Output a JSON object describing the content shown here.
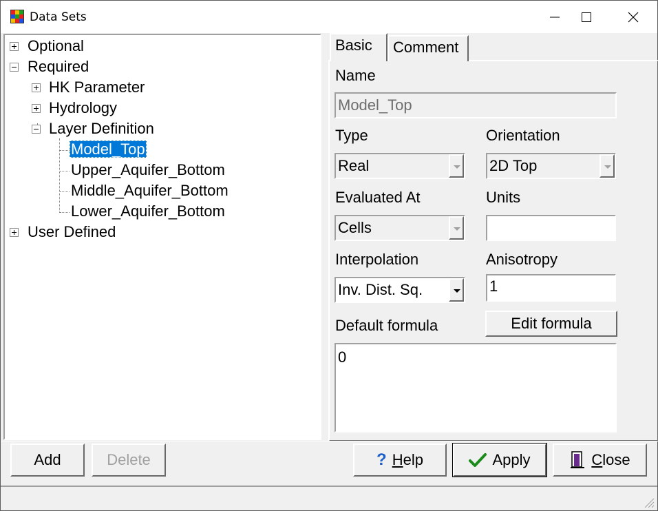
{
  "window": {
    "title": "Data Sets",
    "icon": "app-grid-icon"
  },
  "tree": {
    "nodes": {
      "optional": "Optional",
      "required": "Required",
      "hk_parameter": "HK Parameter",
      "hydrology": "Hydrology",
      "layer_definition": "Layer Definition",
      "model_top": "Model_Top",
      "upper_aquifer_bottom": "Upper_Aquifer_Bottom",
      "middle_aquifer_bottom": "Middle_Aquifer_Bottom",
      "lower_aquifer_bottom": "Lower_Aquifer_Bottom",
      "user_defined": "User Defined"
    },
    "selected": "Model_Top"
  },
  "tabs": {
    "basic": "Basic",
    "comment": "Comment",
    "active": "Basic"
  },
  "form": {
    "name_label": "Name",
    "name_value": "Model_Top",
    "type_label": "Type",
    "type_value": "Real",
    "orientation_label": "Orientation",
    "orientation_value": "2D Top",
    "evaluated_label": "Evaluated At",
    "evaluated_value": "Cells",
    "units_label": "Units",
    "units_value": "",
    "interpolation_label": "Interpolation",
    "interpolation_value": "Inv. Dist. Sq.",
    "anisotropy_label": "Anisotropy",
    "anisotropy_value": "1",
    "default_formula_label": "Default formula",
    "edit_formula_label": "Edit formula",
    "formula_value": "0"
  },
  "buttons": {
    "add": "Add",
    "delete": "Delete",
    "help": "Help",
    "apply": "Apply",
    "close": "Close"
  },
  "colors": {
    "selection": "#0078d7",
    "face": "#f0f0f0",
    "check_green": "#1a8a1a",
    "help_blue": "#1e5fc8"
  }
}
